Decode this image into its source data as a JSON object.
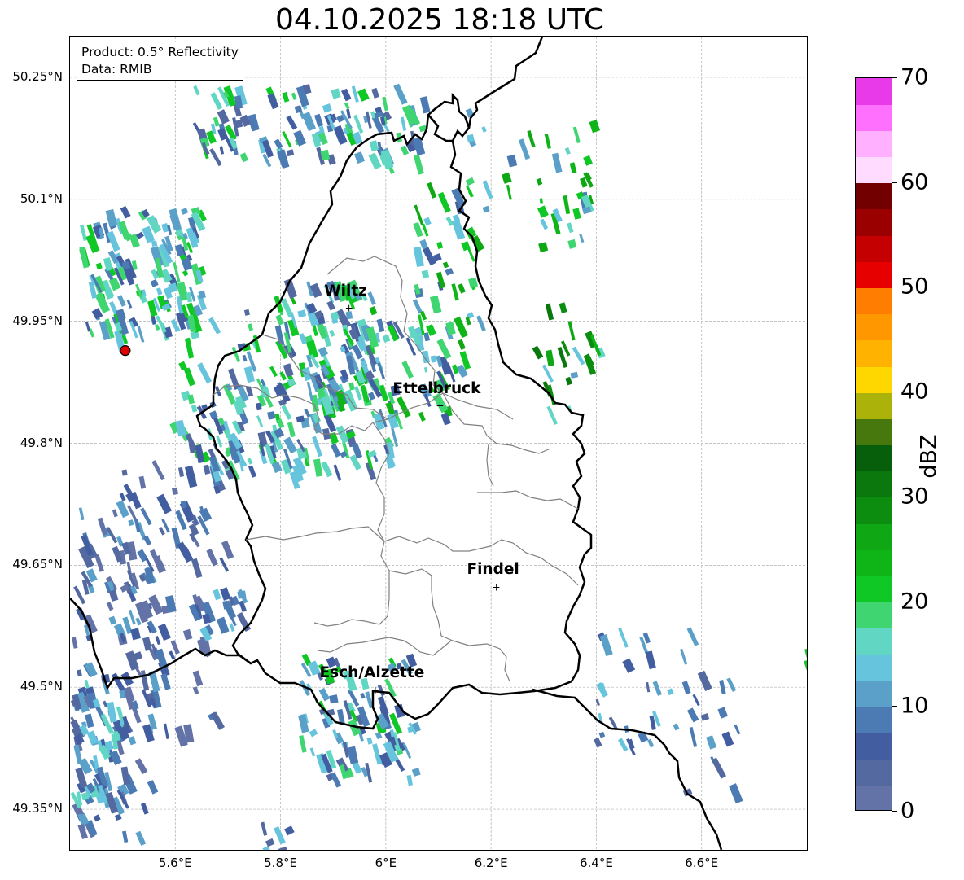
{
  "title": "04.10.2025 18:18 UTC",
  "info": {
    "product": "Product: 0.5° Reflectivity",
    "source": "Data: RMIB"
  },
  "map": {
    "lon_range": [
      5.4,
      6.8
    ],
    "lat_range": [
      49.3,
      50.3
    ],
    "lat_ticks": [
      {
        "value": 50.25,
        "label": "50.25°N"
      },
      {
        "value": 50.1,
        "label": "50.1°N"
      },
      {
        "value": 49.95,
        "label": "49.95°N"
      },
      {
        "value": 49.8,
        "label": "49.8°N"
      },
      {
        "value": 49.65,
        "label": "49.65°N"
      },
      {
        "value": 49.5,
        "label": "49.5°N"
      },
      {
        "value": 49.35,
        "label": "49.35°N"
      }
    ],
    "lon_ticks": [
      {
        "value": 5.6,
        "label": "5.6°E"
      },
      {
        "value": 5.8,
        "label": "5.8°E"
      },
      {
        "value": 6.0,
        "label": "6°E"
      },
      {
        "value": 6.2,
        "label": "6.2°E"
      },
      {
        "value": 6.4,
        "label": "6.4°E"
      },
      {
        "value": 6.6,
        "label": "6.6°E"
      }
    ],
    "cities": [
      {
        "name": "Wiltz",
        "lon": 5.93,
        "lat": 49.967
      },
      {
        "name": "Ettelbruck",
        "lon": 6.103,
        "lat": 49.847
      },
      {
        "name": "Findel",
        "lon": 6.21,
        "lat": 49.624
      },
      {
        "name": "Esch/Alzette",
        "lon": 5.98,
        "lat": 49.497
      }
    ],
    "radar_site": {
      "lon": 5.505,
      "lat": 49.914
    },
    "grid": true
  },
  "colorbar": {
    "label": "dBZ",
    "min": 0,
    "max": 70,
    "ticks": [
      0,
      10,
      20,
      30,
      40,
      50,
      60,
      70
    ],
    "colors": [
      "#6373a7",
      "#53699f",
      "#425ea1",
      "#4b7bb2",
      "#5ba0c8",
      "#66c4dd",
      "#61d6c3",
      "#3fd570",
      "#10c825",
      "#0fb516",
      "#0fa713",
      "#0d8d10",
      "#0b780e",
      "#075e0b",
      "#47780d",
      "#abb20a",
      "#ffd700",
      "#ffb300",
      "#ff9800",
      "#ff7d00",
      "#e70000",
      "#c40000",
      "#9b0000",
      "#730000",
      "#ffdcff",
      "#ffb0ff",
      "#ff70ff",
      "#e83ae8"
    ]
  }
}
